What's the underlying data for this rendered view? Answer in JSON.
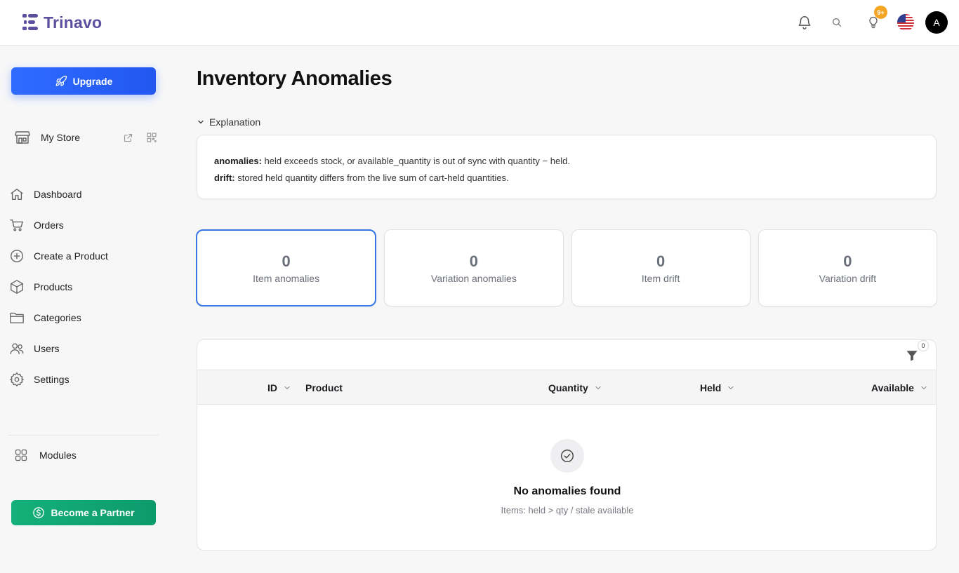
{
  "brand": {
    "name": "Trinavo",
    "color": "#5b4f9e"
  },
  "topbar": {
    "icons": [
      "bell-icon",
      "search-icon",
      "lightbulb-icon",
      "us-flag-icon"
    ],
    "tips_badge": "9+",
    "avatar_initial": "A"
  },
  "sidebar": {
    "upgrade_label": "Upgrade",
    "store": {
      "label": "My Store"
    },
    "items": [
      {
        "label": "Dashboard",
        "icon": "home-icon"
      },
      {
        "label": "Orders",
        "icon": "cart-icon"
      },
      {
        "label": "Create a Product",
        "icon": "plus-circle-icon"
      },
      {
        "label": "Products",
        "icon": "box-icon"
      },
      {
        "label": "Categories",
        "icon": "folder-icon"
      },
      {
        "label": "Users",
        "icon": "users-icon"
      },
      {
        "label": "Settings",
        "icon": "gear-icon"
      }
    ],
    "modules_label": "Modules",
    "partner_label": "Become a Partner"
  },
  "main": {
    "title": "Inventory Anomalies",
    "explanation": {
      "toggle_label": "Explanation",
      "lines": [
        {
          "term": "anomalies:",
          "text": " held exceeds stock, or available_quantity is out of sync with quantity − held."
        },
        {
          "term": "drift:",
          "text": " stored held quantity differs from the live sum of cart-held quantities."
        }
      ]
    },
    "stats": [
      {
        "value": "0",
        "label": "Item anomalies"
      },
      {
        "value": "0",
        "label": "Variation anomalies"
      },
      {
        "value": "0",
        "label": "Item drift"
      },
      {
        "value": "0",
        "label": "Variation drift"
      }
    ],
    "table": {
      "filter_count": "0",
      "columns": [
        {
          "label": "ID"
        },
        {
          "label": "Product"
        },
        {
          "label": "Quantity"
        },
        {
          "label": "Held"
        },
        {
          "label": "Available"
        }
      ],
      "empty_title": "No anomalies found",
      "empty_subtitle": "Items: held > qty / stale available"
    },
    "accent_color": "#3577e6"
  }
}
